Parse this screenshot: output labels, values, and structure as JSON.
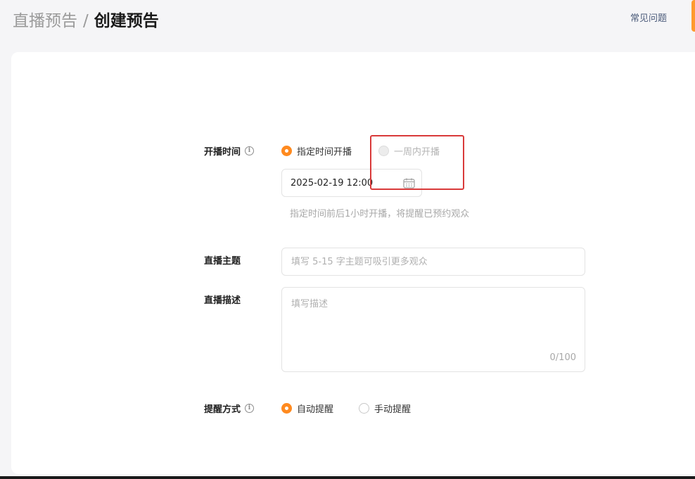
{
  "header": {
    "breadcrumb_parent": "直播预告",
    "breadcrumb_separator": "/",
    "breadcrumb_current": "创建预告",
    "faq_link": "常见问题"
  },
  "form": {
    "start_time": {
      "label": "开播时间",
      "info_icon": "info-icon",
      "options": [
        {
          "label": "指定时间开播",
          "checked": true,
          "disabled": false
        },
        {
          "label": "一周内开播",
          "checked": false,
          "disabled": true
        }
      ],
      "date_value": "2025-02-19 12:00",
      "calendar_icon": "calendar-icon",
      "hint": "指定时间前后1小时开播，将提醒已预约观众"
    },
    "topic": {
      "label": "直播主题",
      "value": "",
      "placeholder": "填写 5-15 字主题可吸引更多观众"
    },
    "description": {
      "label": "直播描述",
      "value": "",
      "placeholder": "填写描述",
      "char_count": "0/100"
    },
    "reminder": {
      "label": "提醒方式",
      "info_icon": "info-icon",
      "options": [
        {
          "label": "自动提醒",
          "checked": true
        },
        {
          "label": "手动提醒",
          "checked": false
        }
      ]
    }
  },
  "colors": {
    "accent": "#ff8a1f",
    "highlight": "#d93a3a",
    "card": "#ffffff",
    "background": "#f5f5f7"
  }
}
